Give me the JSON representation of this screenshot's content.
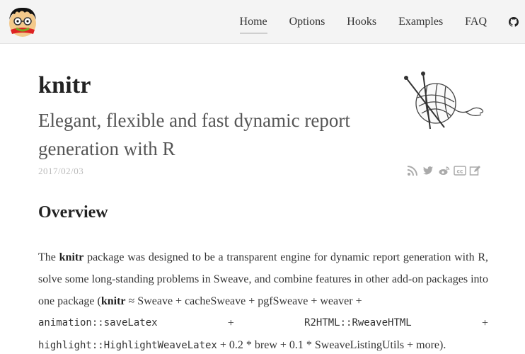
{
  "nav": {
    "items": [
      {
        "label": "Home",
        "active": true
      },
      {
        "label": "Options"
      },
      {
        "label": "Hooks"
      },
      {
        "label": "Examples"
      },
      {
        "label": "FAQ"
      }
    ],
    "github_icon": "github-icon"
  },
  "header": {
    "title": "knitr",
    "subtitle": "Elegant, flexible and fast dynamic report generation with R",
    "date": "2017/02/03"
  },
  "share_icons": [
    "rss-icon",
    "twitter-icon",
    "weibo-icon",
    "cc-icon",
    "edit-icon"
  ],
  "overview": {
    "heading": "Overview",
    "p1": "The ",
    "p1_bold": "knitr",
    "p2": " package was designed to be a transparent engine for dynamic report generation with R, solve some long-standing problems in Sweave, and combine features in other add-on packages into one package (",
    "p2_bold": "knitr",
    "p3": " ≈ Sweave + cacheSweave + pgfSweave + weaver +",
    "code1": "animation::saveLatex",
    "plus": "+",
    "code2": "R2HTML::RweaveHTML",
    "code3": "highlight::HighlightWeaveLatex",
    "p4": " + 0.2 * brew + 0.1 * SweaveListingUtils + more)."
  },
  "colors": {
    "navbar_bg": "#f4f4f4",
    "subtitle": "#555555",
    "date": "#bbbbbb",
    "icon": "#aaaaaa"
  }
}
